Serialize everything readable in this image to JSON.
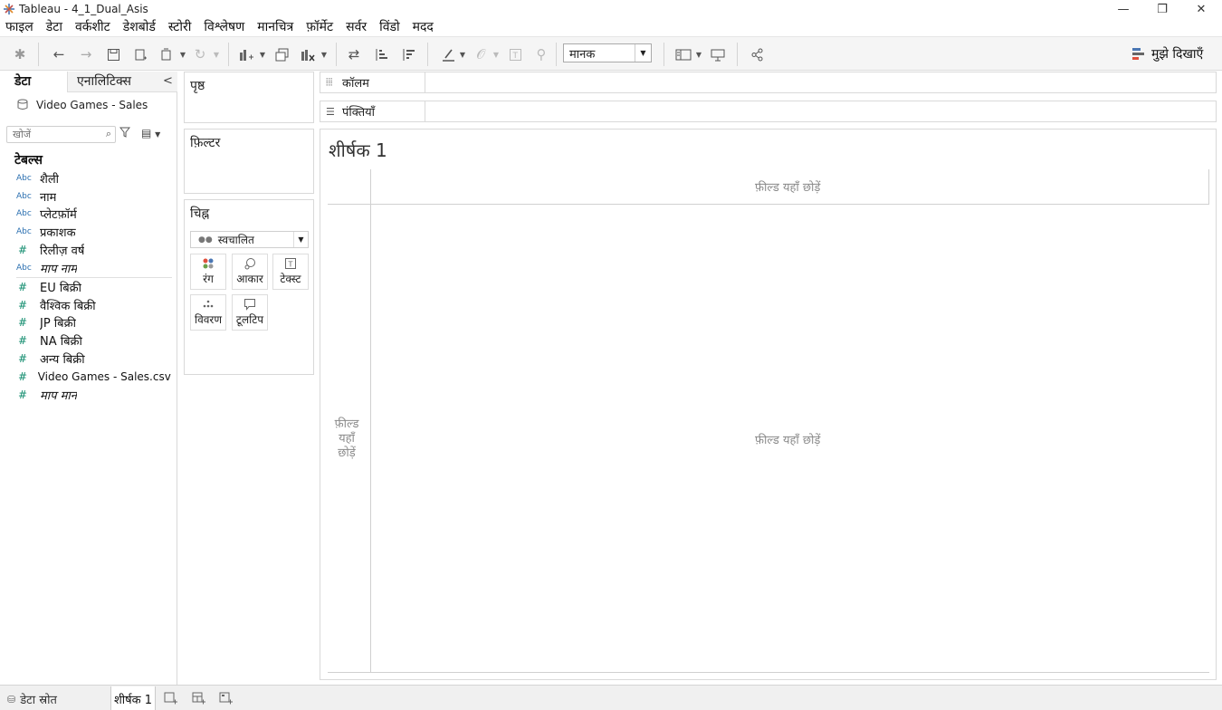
{
  "window": {
    "title": "Tableau - 4_1_Dual_Asis",
    "minimize_glyph": "—",
    "restore_glyph": "❐",
    "close_glyph": "✕"
  },
  "menu": [
    "फाइल",
    "डेटा",
    "वर्कशीट",
    "डेशबोर्ड",
    "स्टोरी",
    "विश्लेषण",
    "मानचित्र",
    "फ़ॉर्मेट",
    "सर्वर",
    "विंडो",
    "मदद"
  ],
  "toolbar": {
    "fit_value": "मानक",
    "show_me_label": "मुझे दिखाएँ"
  },
  "data_pane": {
    "tab_data": "डेटा",
    "tab_analytics": "एनालिटिक्स",
    "datasource": "Video Games - Sales",
    "search_placeholder": "खोजें",
    "tables_heading": "टेबल्स",
    "fields": [
      {
        "type": "Abc",
        "name": "शैली",
        "italic": false
      },
      {
        "type": "Abc",
        "name": "नाम",
        "italic": false
      },
      {
        "type": "Abc",
        "name": "प्लेटफ़ॉर्म",
        "italic": false
      },
      {
        "type": "Abc",
        "name": "प्रकाशक",
        "italic": false
      },
      {
        "type": "#",
        "name": "रिलीज़ वर्ष",
        "italic": false
      },
      {
        "type": "Abc",
        "name": "माप नाम",
        "italic": true
      },
      {
        "type": "#",
        "name": "EU बिक्री",
        "italic": false
      },
      {
        "type": "#",
        "name": "वैश्विक बिक्री",
        "italic": false
      },
      {
        "type": "#",
        "name": "JP बिक्री",
        "italic": false
      },
      {
        "type": "#",
        "name": "NA बिक्री",
        "italic": false
      },
      {
        "type": "#",
        "name": "अन्य बिक्री",
        "italic": false
      },
      {
        "type": "#",
        "name": "Video Games - Sales.csv (...",
        "italic": false
      },
      {
        "type": "#",
        "name": "माप मान",
        "italic": true
      }
    ]
  },
  "cards": {
    "pages": "पृष्ठ",
    "filters": "फ़िल्टर",
    "marks": "चिह्न",
    "mark_type": "स्वचालित",
    "mark_buttons": {
      "color": "रंग",
      "size": "आकार",
      "text": "टेक्स्ट",
      "detail": "विवरण",
      "tooltip": "टूलटिप"
    }
  },
  "shelves": {
    "columns": "कॉलम",
    "rows": "पंक्तियाँ"
  },
  "view": {
    "sheet_title": "शीर्षक 1",
    "drop_field_here": "फ़ील्ड यहाँ छोड़ें",
    "drop_vertical_line1": "फ़ील्ड",
    "drop_vertical_line2": "यहाँ",
    "drop_vertical_line3": "छोड़ें"
  },
  "bottom": {
    "datasource_tab": "डेटा स्रोत",
    "sheet_tab": "शीर्षक 1"
  }
}
